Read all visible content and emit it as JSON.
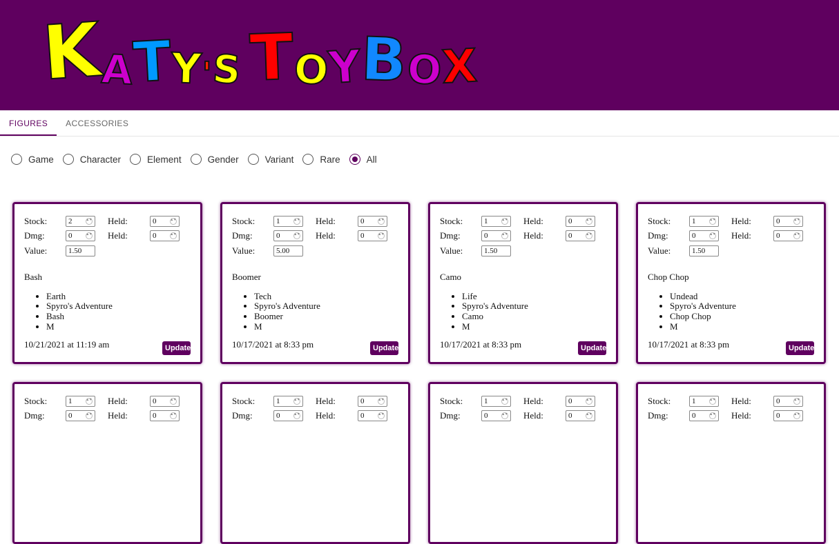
{
  "brand": {
    "logo_letters": [
      "K",
      "A",
      "T",
      "Y",
      "'",
      "S",
      "T",
      "O",
      "Y",
      "B",
      "O",
      "X"
    ],
    "logo_colors": [
      "#ffff00",
      "#cc00cc",
      "#0099ff",
      "#ffff00",
      "#ff2200",
      "#ffff00",
      "#ff0000",
      "#ffff00",
      "#cc00cc",
      "#1188ff",
      "#cc00cc",
      "#ff0000"
    ],
    "accent_color": "#5f005f"
  },
  "tabs": [
    {
      "label": "FIGURES",
      "active": true
    },
    {
      "label": "ACCESSORIES",
      "active": false
    }
  ],
  "filters": [
    {
      "label": "Game",
      "checked": false
    },
    {
      "label": "Character",
      "checked": false
    },
    {
      "label": "Element",
      "checked": false
    },
    {
      "label": "Gender",
      "checked": false
    },
    {
      "label": "Variant",
      "checked": false
    },
    {
      "label": "Rare",
      "checked": false
    },
    {
      "label": "All",
      "checked": true
    }
  ],
  "labels": {
    "stock": "Stock:",
    "held": "Held:",
    "dmg": "Dmg:",
    "value": "Value:",
    "update": "Update"
  },
  "cards": [
    {
      "stock": "2",
      "held1": "0",
      "dmg": "0",
      "held2": "0",
      "value": "1.50",
      "name": "Bash",
      "details": [
        "Earth",
        "Spyro's Adventure",
        "Bash",
        "M"
      ],
      "date": "10/21/2021 at 11:19 am"
    },
    {
      "stock": "1",
      "held1": "0",
      "dmg": "0",
      "held2": "0",
      "value": "5.00",
      "name": "Boomer",
      "details": [
        "Tech",
        "Spyro's Adventure",
        "Boomer",
        "M"
      ],
      "date": "10/17/2021 at 8:33 pm"
    },
    {
      "stock": "1",
      "held1": "0",
      "dmg": "0",
      "held2": "0",
      "value": "1.50",
      "name": "Camo",
      "details": [
        "Life",
        "Spyro's Adventure",
        "Camo",
        "M"
      ],
      "date": "10/17/2021 at 8:33 pm"
    },
    {
      "stock": "1",
      "held1": "0",
      "dmg": "0",
      "held2": "0",
      "value": "1.50",
      "name": "Chop Chop",
      "details": [
        "Undead",
        "Spyro's Adventure",
        "Chop Chop",
        "M"
      ],
      "date": "10/17/2021 at 8:33 pm"
    },
    {
      "stock": "1",
      "held1": "0",
      "dmg": "0",
      "held2": "0"
    },
    {
      "stock": "1",
      "held1": "0",
      "dmg": "0",
      "held2": "0"
    },
    {
      "stock": "1",
      "held1": "0",
      "dmg": "0",
      "held2": "0"
    },
    {
      "stock": "1",
      "held1": "0",
      "dmg": "0",
      "held2": "0"
    }
  ]
}
